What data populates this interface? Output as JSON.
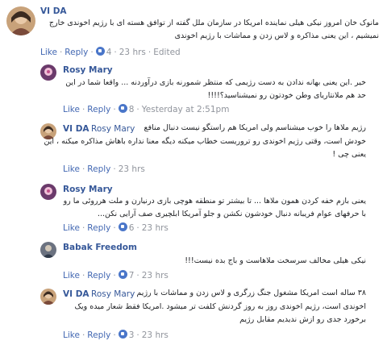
{
  "comments": [
    {
      "author": "VI DA",
      "lines": [
        "مانوک خان امروز نیکی هیلی نماینده امریکا در سازمان ملل گفته از توافق هسته ای با رژیم اخوندی خارج",
        "نمیشیم ، این یعنی مذاکره و لاس زدن و مماشات با رژیم اخوندی"
      ],
      "like": "Like",
      "reply": "Reply",
      "likes": "4",
      "time": "23 hrs",
      "edited": "Edited"
    },
    {
      "author": "Rosy Mary",
      "lines": [
        "خیر .این یعنی بهانه ندادن به دست رژیمی که منتظر شمورنه بازی درآوردنه ... واقعا شما در این",
        "حد هم ملانتاریای وطن خودتون رو نمیشناسید؟!!!!"
      ],
      "like": "Like",
      "reply": "Reply",
      "likes": "8",
      "time": "Yesterday at 2:51pm"
    },
    {
      "author": "VI DA",
      "mention": "Rosy Mary",
      "lines": [
        "رژیم ملاها را خوب میشناسم ولی امریکا هم راستگو نیست دنبال منافع",
        "خودش است، وقتی رژیم اخوندی رو تروریست خطاب میکنه دیگه معنا نداره باهاش مذاکره میکنه ، این",
        "یعنی چی !"
      ],
      "like": "Like",
      "reply": "Reply",
      "likes": "",
      "time": "23 hrs"
    },
    {
      "author": "Rosy Mary",
      "lines": [
        "یعنی بازم خفه کردن همون ملاها ... تا بیشتر تو منطقه هوچی بازی درنیارن و ملت هرروئی ما رو",
        "با حرفهای عوام فریبانه دنبال خودشون نکشن و جلو آمریکا ابلچیری صف آرایی نکن..."
      ],
      "like": "Like",
      "reply": "Reply",
      "likes": "6",
      "time": "23 hrs"
    },
    {
      "author": "Babak Freedom",
      "lines": [
        "نیکی هیلی مخالف سرسخت ملاهاست و باج بده نیست!!!"
      ],
      "like": "Like",
      "reply": "Reply",
      "likes": "7",
      "time": "23 hrs"
    },
    {
      "author": "VI DA",
      "mention": "Rosy Mary",
      "lines": [
        "۳۸ ساله است امریکا مشغول جنگ زرگری و لاس زدن و مماشات با رژیم",
        "اخوندی است، رژیم اخوندی روز به روز گردنش کلفت تر میشود .امریکا فقط شعار میده ویک",
        "برخورد جدی رو ازش ندیدیم مقابل رژیم"
      ],
      "like": "Like",
      "reply": "Reply",
      "likes": "3",
      "time": "23 hrs"
    }
  ],
  "colors": {
    "link": "#4267b2",
    "author": "#365899",
    "meta": "#90949c",
    "thumb": "#4a76c9"
  }
}
